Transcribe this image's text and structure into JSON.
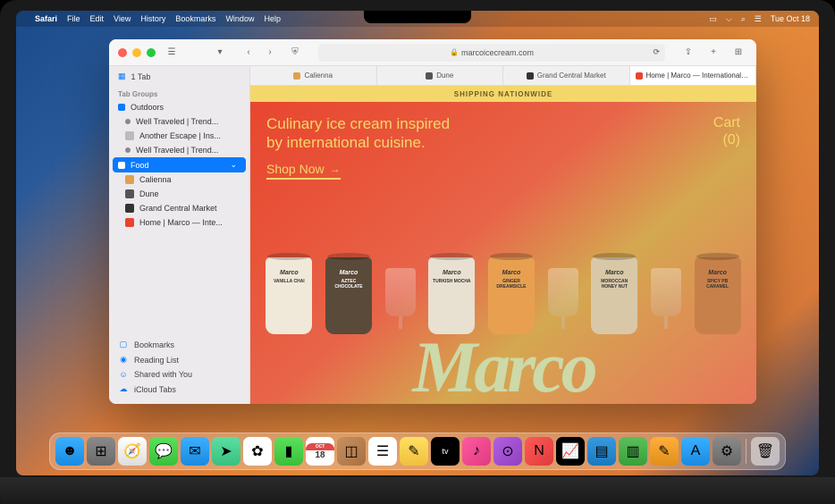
{
  "menubar": {
    "app_name": "Safari",
    "items": [
      "File",
      "Edit",
      "View",
      "History",
      "Bookmarks",
      "Window",
      "Help"
    ],
    "datetime": "Tue Oct 18"
  },
  "toolbar": {
    "url": "marcoicecream.com",
    "tab_count": "1 Tab"
  },
  "sidebar": {
    "section_label": "Tab Groups",
    "groups": [
      {
        "name": "Outdoors",
        "tabs": [
          "Well Traveled | Trend...",
          "Another Escape | Ins...",
          "Well Traveled | Trend..."
        ]
      },
      {
        "name": "Food",
        "tabs": [
          "Calienna",
          "Dune",
          "Grand Central Market",
          "Home | Marco — Inte..."
        ]
      }
    ],
    "bottom": [
      "Bookmarks",
      "Reading List",
      "Shared with You",
      "iCloud Tabs"
    ]
  },
  "tabs": [
    {
      "label": "Calienna",
      "active": false
    },
    {
      "label": "Dune",
      "active": false
    },
    {
      "label": "Grand Central Market",
      "active": false
    },
    {
      "label": "Home | Marco — International Ice...",
      "active": true
    }
  ],
  "page": {
    "banner": "SHIPPING NATIONWIDE",
    "hero_copy": "Culinary ice cream inspired by international cuisine.",
    "cart_label": "Cart",
    "cart_count": "(0)",
    "cta": "Shop Now",
    "brand": "Marco",
    "pints": [
      {
        "flavor": "VANILLA CHAI",
        "color": "#f0e8d8"
      },
      {
        "flavor": "AZTEC CHOCOLATE",
        "color": "#5a4a3a"
      },
      {
        "flavor": "TURKISH MOCHA",
        "color": "#e8e0d0"
      },
      {
        "flavor": "GINGER DREAMSICLE",
        "color": "#e8a050"
      },
      {
        "flavor": "MOROCCAN HONEY NUT",
        "color": "#d8c8a8"
      },
      {
        "flavor": "SPICY PB CARAMEL",
        "color": "#c8804a"
      }
    ]
  },
  "dock": {
    "apps": [
      "Finder",
      "Launchpad",
      "Safari",
      "Messages",
      "Mail",
      "Maps",
      "Photos",
      "FaceTime",
      "Calendar",
      "Contacts",
      "Reminders",
      "Notes",
      "TV",
      "Music",
      "Podcasts",
      "News",
      "Stocks",
      "Keynote",
      "Numbers",
      "Pages",
      "App Store",
      "System Settings"
    ],
    "cal_month": "OCT",
    "cal_day": "18",
    "trash": "Trash"
  }
}
